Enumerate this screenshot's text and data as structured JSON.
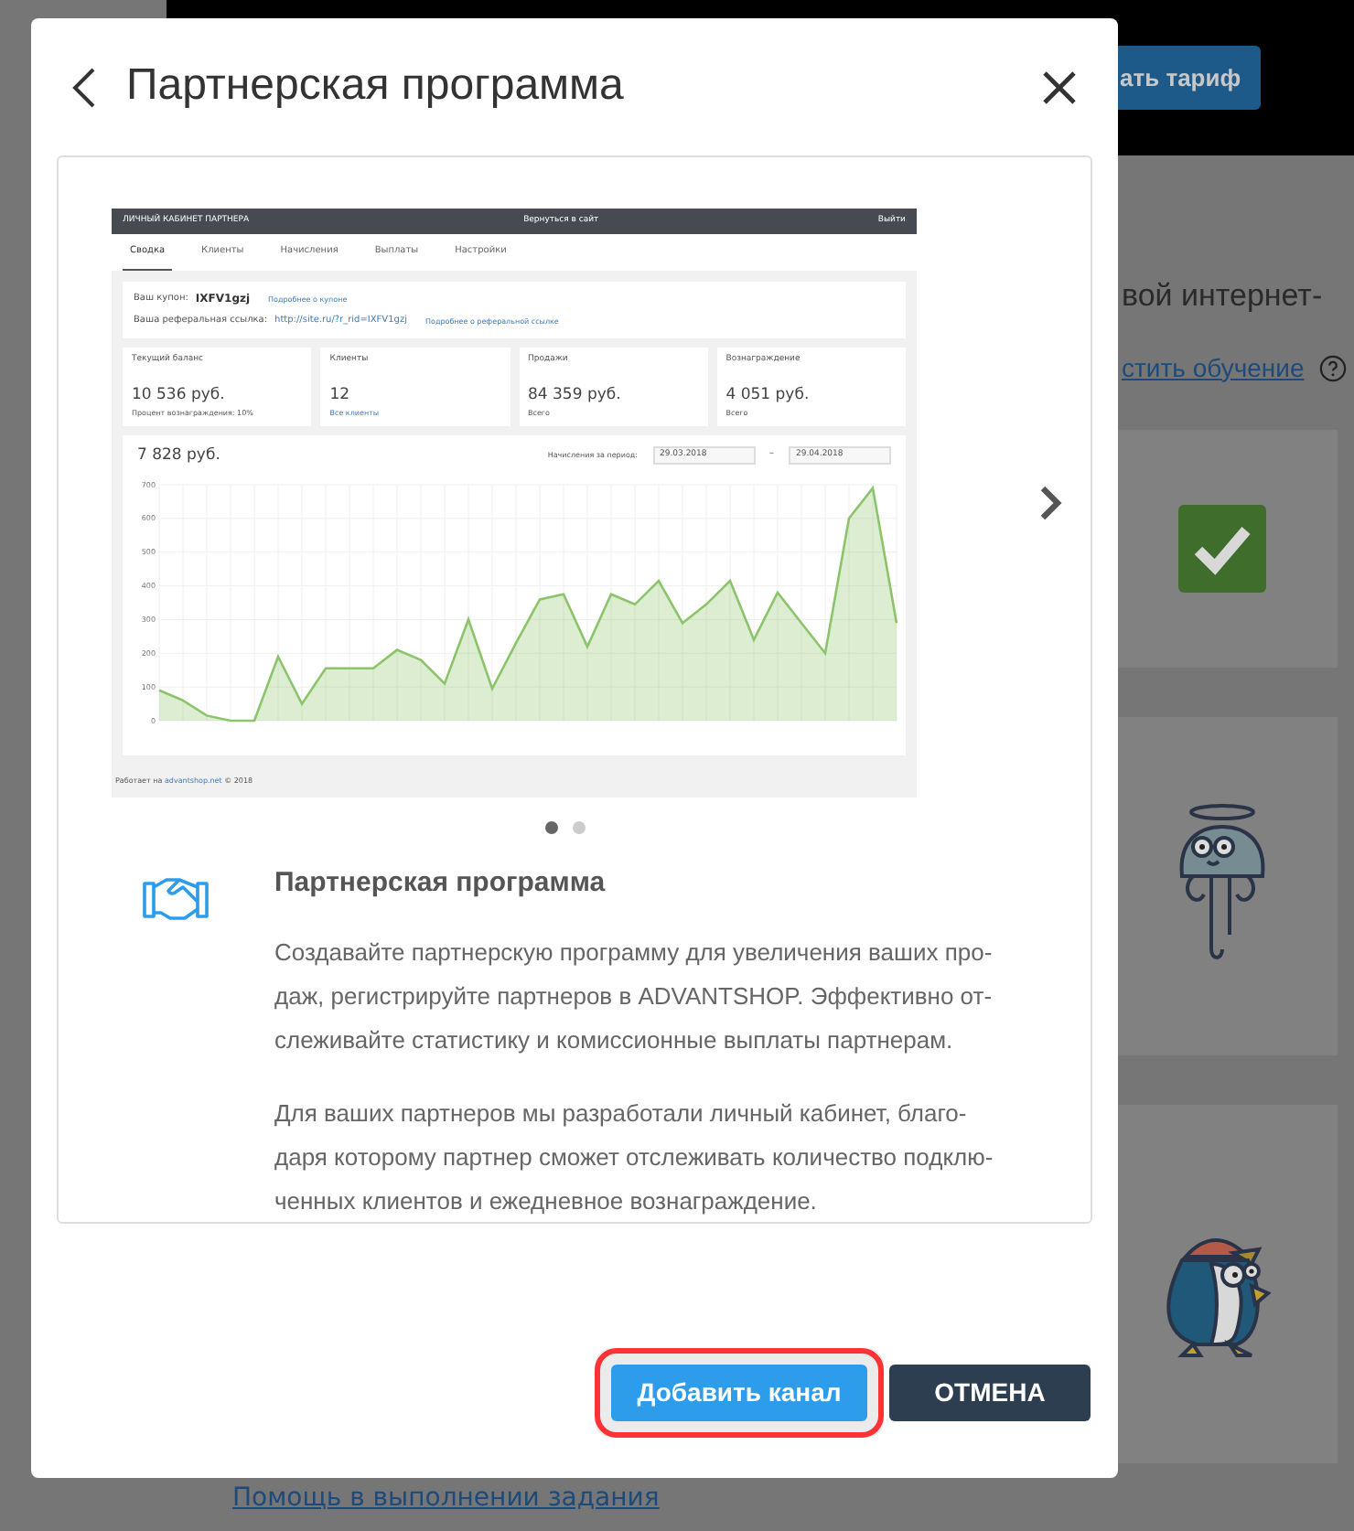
{
  "background": {
    "plan_button": "ать тариф",
    "intro_text": "вой интернет-",
    "tutorial_link": "стить обучение",
    "help_link": "Помощь в выполнении задания",
    "task_cards": [
      {
        "kind": "check"
      },
      {
        "kind": "jellyfish"
      },
      {
        "kind": "penguin"
      }
    ]
  },
  "modal": {
    "title": "Партнерская программа",
    "screenshot": {
      "header_title": "ЛИЧНЫЙ КАБИНЕТ ПАРТНЕРА",
      "header_link": "Вернуться в сайт",
      "logout": "Выйти",
      "tabs": [
        {
          "label": "Сводка",
          "selected": true
        },
        {
          "label": "Клиенты",
          "selected": false
        },
        {
          "label": "Начисления",
          "selected": false
        },
        {
          "label": "Выплаты",
          "selected": false
        },
        {
          "label": "Настройки",
          "selected": false
        }
      ],
      "coupon_label": "Ваш купон:",
      "coupon_code": "IXFV1gzj",
      "coupon_link": "Подробнее о купоне",
      "ref_label": "Ваша реферальная ссылка:",
      "ref_url": "http://site.ru/?r_rid=IXFV1gzj",
      "ref_link": "Подробнее о реферальной ссылке",
      "stats": [
        {
          "title": "Текущий баланс",
          "value": "10 536 руб.",
          "note": "Процент вознаграждения: 10%",
          "note_link": false
        },
        {
          "title": "Клиенты",
          "value": "12",
          "note": "Все клиенты",
          "note_link": true
        },
        {
          "title": "Продажи",
          "value": "84 359 руб.",
          "note": "Всего",
          "note_link": false
        },
        {
          "title": "Вознаграждение",
          "value": "4 051 руб.",
          "note": "Всего",
          "note_link": false
        }
      ],
      "chart_total": "7 828 руб.",
      "period_label": "Начисления за период:",
      "date_from": "29.03.2018",
      "date_separator": "–",
      "date_to": "29.04.2018",
      "chart_data": {
        "type": "area",
        "grid": true,
        "ylim": [
          0,
          700
        ],
        "yticks": [
          0,
          100,
          200,
          300,
          400,
          500,
          600,
          700
        ],
        "series": [
          {
            "color": "#8bc46a",
            "values": [
              90,
              60,
              15,
              0,
              0,
              190,
              50,
              155,
              155,
              155,
              210,
              180,
              110,
              300,
              95,
              230,
              360,
              375,
              220,
              375,
              345,
              415,
              290,
              345,
              415,
              240,
              380,
              290,
              200,
              600,
              690,
              290
            ]
          }
        ]
      },
      "footer_text": "Работает на",
      "footer_link": "advantshop.net",
      "footer_year": "© 2018"
    },
    "slides": [
      {
        "selected": true
      },
      {
        "selected": false
      }
    ],
    "feature": {
      "title": "Партнерская программа",
      "paragraphs": [
        {
          "lines": [
            "Создавайте партнерскую программу для увеличения ваших про-",
            "даж, регистрируйте партнеров в ADVANTSHOP. Эффективно от-",
            "слеживайте статистику и комиссионные выплаты партнерам."
          ]
        },
        {
          "lines": [
            "Для ваших партнеров мы разработали личный кабинет, благо-",
            "даря которому партнер сможет отслеживать количество подклю-",
            "ченных клиентов и ежедневное вознаграждение."
          ]
        }
      ]
    },
    "buttons": [
      {
        "label": "Добавить канал",
        "kind": "primary",
        "highlighted": true
      },
      {
        "label": "ОТМЕНА",
        "kind": "secondary",
        "highlighted": false
      }
    ]
  }
}
